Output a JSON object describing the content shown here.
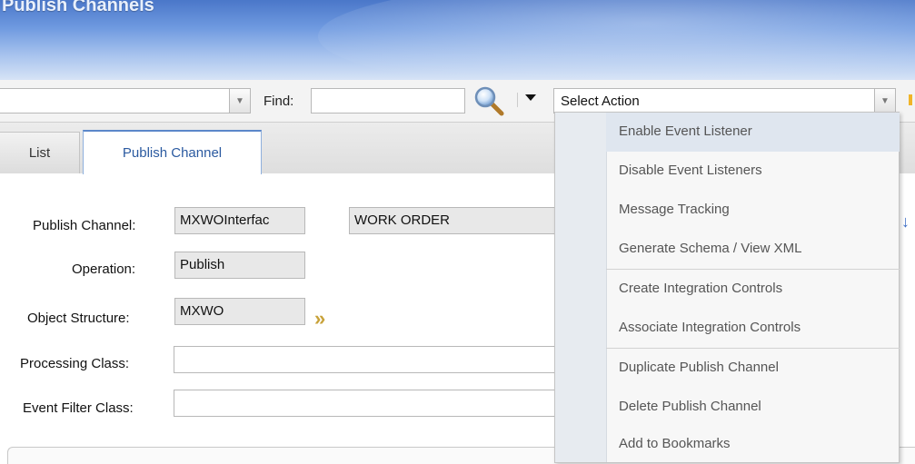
{
  "app": {
    "title": "Publish Channels"
  },
  "toolbar": {
    "find_label": "Find:",
    "find_value": "",
    "select_action": "Select Action"
  },
  "tabs": [
    {
      "label": "List"
    },
    {
      "label": "Publish Channel"
    }
  ],
  "form": {
    "publish_channel": {
      "label": "Publish Channel:",
      "value": "MXWOInterfac",
      "description": "WORK ORDER"
    },
    "operation": {
      "label": "Operation:",
      "value": "Publish"
    },
    "object_structure": {
      "label": "Object Structure:",
      "value": "MXWO"
    },
    "processing_class": {
      "label": "Processing Class:",
      "value": ""
    },
    "event_filter_class": {
      "label": "Event Filter Class:",
      "value": ""
    }
  },
  "action_menu": {
    "items": [
      {
        "label": "Enable Event Listener"
      },
      {
        "label": "Disable Event Listeners"
      },
      {
        "label": "Message Tracking"
      },
      {
        "label": "Generate Schema / View XML"
      },
      {
        "label": "Create Integration Controls"
      },
      {
        "label": "Associate Integration Controls"
      },
      {
        "label": "Duplicate Publish Channel"
      },
      {
        "label": "Delete Publish Channel"
      },
      {
        "label": "Add to Bookmarks"
      }
    ]
  },
  "colors": {
    "banner": "#4a77c9",
    "tab_active_text": "#2b5aa0",
    "menu_highlight": "#dfe6ef",
    "chevron": "#c8a23a"
  }
}
